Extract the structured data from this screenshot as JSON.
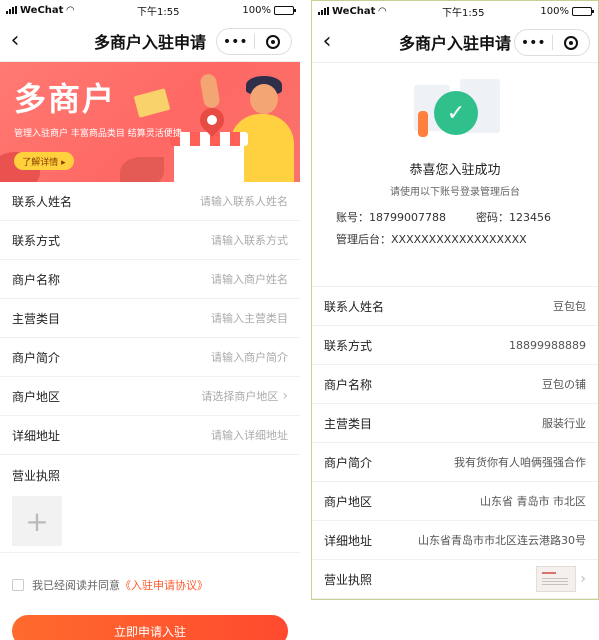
{
  "statusbar": {
    "carrier": "WeChat",
    "time": "下午1:55",
    "battery": "100%"
  },
  "navbar": {
    "title": "多商户入驻申请",
    "more": "•••"
  },
  "banner": {
    "title": "多商户",
    "subtitle": "管理入驻商户  丰富商品类目  结算灵活便捷",
    "button": "了解详情 ▸"
  },
  "form": {
    "fields": [
      {
        "label": "联系人姓名",
        "placeholder": "请输入联系人姓名"
      },
      {
        "label": "联系方式",
        "placeholder": "请输入联系方式"
      },
      {
        "label": "商户名称",
        "placeholder": "请输入商户姓名"
      },
      {
        "label": "主营类目",
        "placeholder": "请输入主营类目"
      },
      {
        "label": "商户简介",
        "placeholder": "请输入商户简介"
      },
      {
        "label": "商户地区",
        "placeholder": "请选择商户地区"
      },
      {
        "label": "详细地址",
        "placeholder": "请输入详细地址"
      }
    ],
    "license_label": "营业执照",
    "upload_symbol": "+",
    "agree_text": "我已经阅读并同意",
    "agree_link": "《入驻申请协议》",
    "submit": "立即申请入驻"
  },
  "success": {
    "title": "恭喜您入驻成功",
    "subtitle": "请使用以下账号登录管理后台",
    "account": "账号：18799007788",
    "password": "密码：123456",
    "admin": "管理后台：XXXXXXXXXXXXXXXXXX",
    "rows": [
      {
        "label": "联系人姓名",
        "value": "豆包包"
      },
      {
        "label": "联系方式",
        "value": "18899988889"
      },
      {
        "label": "商户名称",
        "value": "豆包の铺"
      },
      {
        "label": "主营类目",
        "value": "服装行业"
      },
      {
        "label": "商户简介",
        "value": "我有货你有人咱俩强强合作"
      },
      {
        "label": "商户地区",
        "value": "山东省  青岛市  市北区"
      },
      {
        "label": "详细地址",
        "value": "山东省青岛市市北区连云港路30号"
      }
    ],
    "license_label": "营业执照"
  }
}
